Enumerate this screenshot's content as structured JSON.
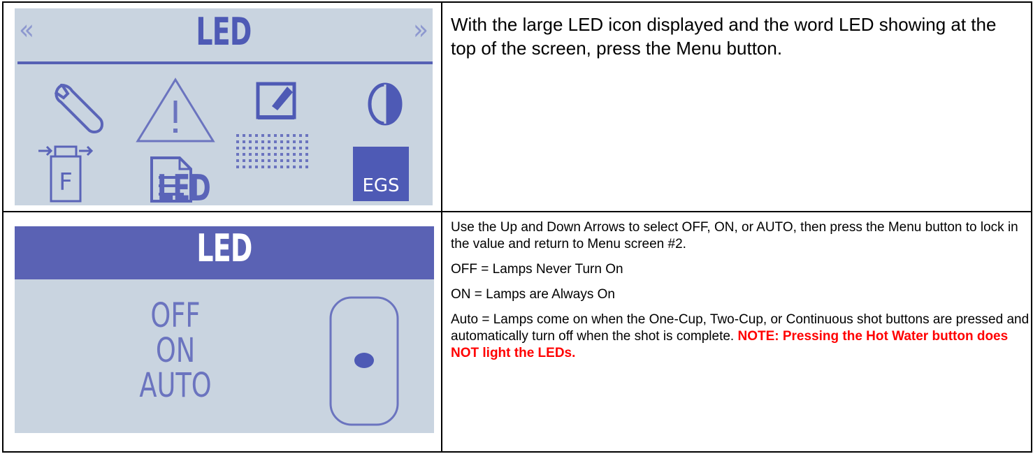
{
  "screen1": {
    "title": "LED",
    "nav_left": "«",
    "nav_right": "»",
    "icons": [
      "wrench-icon",
      "warning-icon",
      "edit-icon",
      "circle-half-icon",
      "filter-icon",
      "document-icon",
      "led-grid-icon",
      "egs-icon"
    ],
    "led_icon_label": "LED",
    "egs_label": "EGS",
    "f_label": "F"
  },
  "screen2": {
    "title": "LED",
    "options": [
      "OFF",
      "ON",
      "AUTO"
    ]
  },
  "row1_text": "With the large LED icon displayed and the word LED showing at the top of the screen, press the Menu button.",
  "row2": {
    "instruction": "Use the Up and Down Arrows to select OFF, ON, or AUTO, then press the Menu button to lock in the value and return to Menu screen #2.",
    "off_desc": "OFF = Lamps Never Turn On",
    "on_desc": "ON = Lamps are Always On",
    "auto_desc": "Auto = Lamps come on when the One-Cup, Two-Cup, or Continuous shot buttons are pressed and automatically turn off when the shot is complete.",
    "note": "NOTE: Pressing the Hot Water button does NOT light the LEDs."
  },
  "colors": {
    "lcd_bg": "#c9d4e0",
    "lcd_ink": "#4e5ab5",
    "note": "#ff0000"
  }
}
